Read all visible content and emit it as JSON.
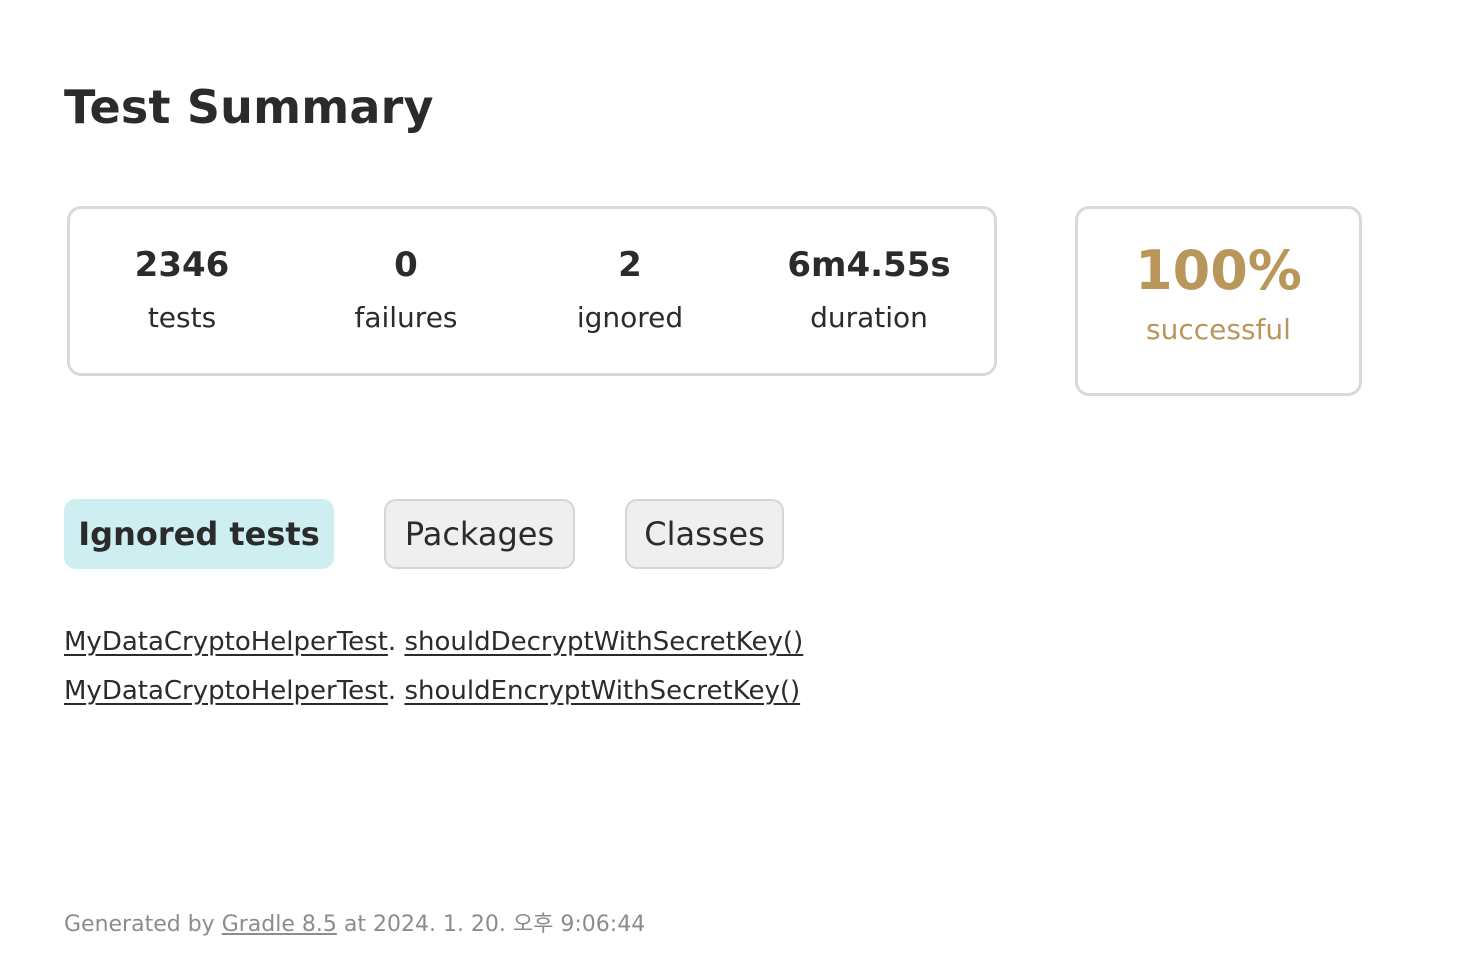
{
  "title": "Test Summary",
  "stats": [
    {
      "value": "2346",
      "label": "tests"
    },
    {
      "value": "0",
      "label": "failures"
    },
    {
      "value": "2",
      "label": "ignored"
    },
    {
      "value": "6m4.55s",
      "label": "duration"
    }
  ],
  "success": {
    "value": "100%",
    "label": "successful"
  },
  "tabs": [
    {
      "label": "Ignored tests",
      "active": true
    },
    {
      "label": "Packages",
      "active": false
    },
    {
      "label": "Classes",
      "active": false
    }
  ],
  "ignored_tests": [
    {
      "class": "MyDataCryptoHelperTest",
      "separator": ".",
      "method": "shouldDecryptWithSecretKey()"
    },
    {
      "class": "MyDataCryptoHelperTest",
      "separator": ".",
      "method": "shouldEncryptWithSecretKey()"
    }
  ],
  "footer": {
    "prefix": "Generated by",
    "link": "Gradle 8.5",
    "suffix": "at 2024. 1. 20. 오후 9:06:44"
  },
  "colors": {
    "success": "#b9975b",
    "active_tab_bg": "#cfeef2",
    "inactive_tab_bg": "#efefef",
    "border": "#d9d9d9"
  }
}
